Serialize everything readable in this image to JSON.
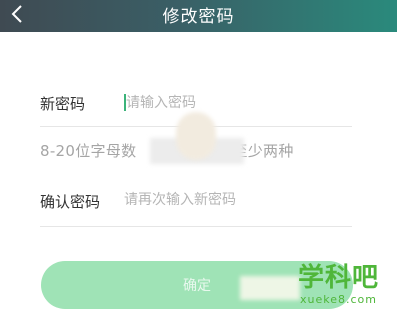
{
  "header": {
    "title": "修改密码",
    "back_icon": "chevron-left-icon",
    "gradient": [
      "#3f4a52",
      "#2a8a7c"
    ]
  },
  "form": {
    "new_password": {
      "label": "新密码",
      "placeholder": "请输入密码",
      "value": ""
    },
    "hint": {
      "text_prefix": "8-20位字母数",
      "text_suffix": "至少两种"
    },
    "confirm_password": {
      "label": "确认密码",
      "placeholder": "请再次输入新密码",
      "value": ""
    }
  },
  "confirm_button": {
    "label": "确定",
    "color": "#9fe3b6"
  },
  "watermark": {
    "main": "学科吧",
    "sub": "xueke8.com",
    "color": "#4fb63a"
  }
}
